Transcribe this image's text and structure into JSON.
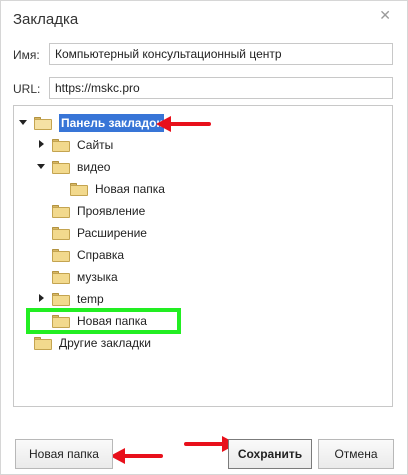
{
  "dialog": {
    "title": "Закладка",
    "close_glyph": "✕"
  },
  "fields": {
    "name_label": "Имя:",
    "name_value": "Компьютерный консультационный центр",
    "url_label": "URL:",
    "url_value": "https://mskc.pro"
  },
  "tree": {
    "bookmarks_bar": "Панель закладок",
    "sites": "Сайты",
    "video": "видео",
    "video_new_folder": "Новая папка",
    "manifestation": "Проявление",
    "extension": "Расширение",
    "help": "Справка",
    "music": "музыка",
    "temp": "temp",
    "new_folder": "Новая папка",
    "other_bookmarks": "Другие закладки"
  },
  "buttons": {
    "new_folder": "Новая папка",
    "save": "Сохранить",
    "cancel": "Отмена"
  },
  "annotations": {
    "arrow_color": "#e8101b",
    "highlight_color": "#22ee22"
  }
}
